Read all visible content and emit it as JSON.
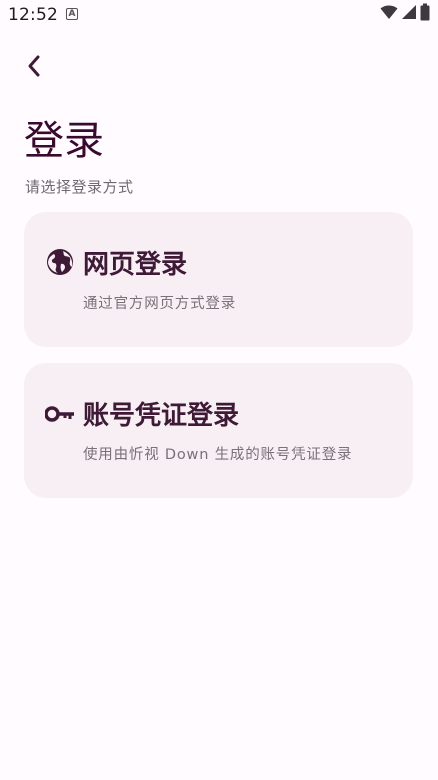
{
  "status_bar": {
    "time": "12:52",
    "notification_glyph": "A",
    "icons": [
      "wifi-icon",
      "signal-icon",
      "battery-icon"
    ]
  },
  "header": {
    "back_icon": "chevron-left-icon",
    "title": "登录",
    "subtitle": "请选择登录方式"
  },
  "options": [
    {
      "icon": "globe-icon",
      "title": "网页登录",
      "description": "通过官方网页方式登录"
    },
    {
      "icon": "key-icon",
      "title": "账号凭证登录",
      "description": "使用由忻视 Down 生成的账号凭证登录"
    }
  ],
  "colors": {
    "background": "#fffbff",
    "card": "#f7eff3",
    "accent": "#3e1a36",
    "subtitle": "#6e6a70"
  }
}
